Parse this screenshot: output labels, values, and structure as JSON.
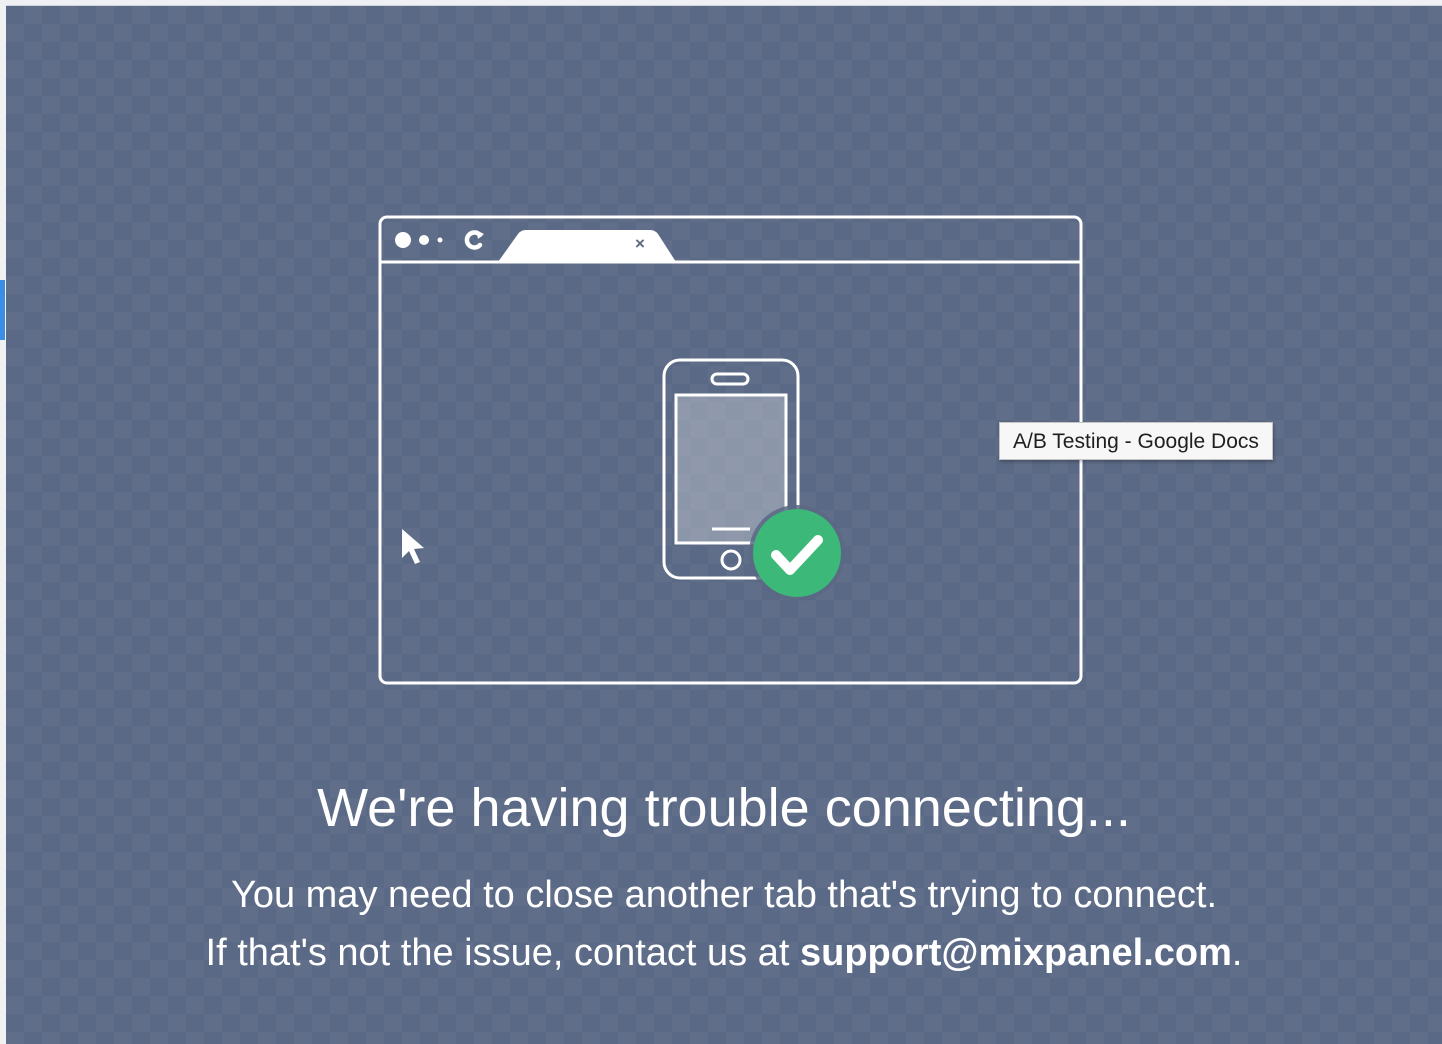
{
  "connection_error": {
    "headline": "We're having trouble connecting...",
    "line1": "You may need to close another tab that's trying to connect.",
    "line2_prefix": "If that's not the issue, contact us at ",
    "support_email": "support@mixpanel.com",
    "line2_suffix": "."
  },
  "tooltip": {
    "text": "A/B Testing - Google Docs"
  },
  "illustration": {
    "tab_close_glyph": "×"
  },
  "colors": {
    "overlay": "#5a6985",
    "check_badge": "#3cb878",
    "illustration_stroke": "#ffffff",
    "tooltip_bg": "#f7f7f7"
  }
}
